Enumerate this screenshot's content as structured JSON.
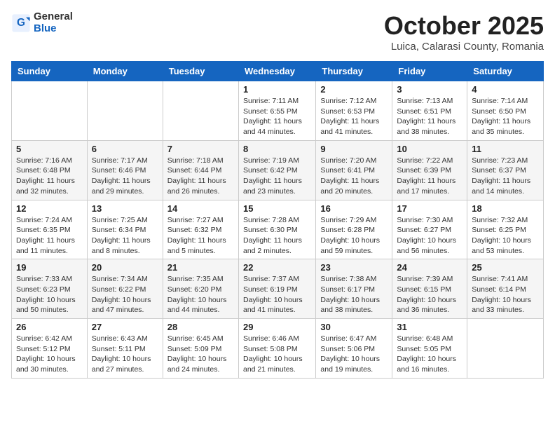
{
  "header": {
    "logo_general": "General",
    "logo_blue": "Blue",
    "month_title": "October 2025",
    "location": "Luica, Calarasi County, Romania"
  },
  "days_of_week": [
    "Sunday",
    "Monday",
    "Tuesday",
    "Wednesday",
    "Thursday",
    "Friday",
    "Saturday"
  ],
  "weeks": [
    [
      {
        "day": "",
        "info": ""
      },
      {
        "day": "",
        "info": ""
      },
      {
        "day": "",
        "info": ""
      },
      {
        "day": "1",
        "info": "Sunrise: 7:11 AM\nSunset: 6:55 PM\nDaylight: 11 hours and 44 minutes."
      },
      {
        "day": "2",
        "info": "Sunrise: 7:12 AM\nSunset: 6:53 PM\nDaylight: 11 hours and 41 minutes."
      },
      {
        "day": "3",
        "info": "Sunrise: 7:13 AM\nSunset: 6:51 PM\nDaylight: 11 hours and 38 minutes."
      },
      {
        "day": "4",
        "info": "Sunrise: 7:14 AM\nSunset: 6:50 PM\nDaylight: 11 hours and 35 minutes."
      }
    ],
    [
      {
        "day": "5",
        "info": "Sunrise: 7:16 AM\nSunset: 6:48 PM\nDaylight: 11 hours and 32 minutes."
      },
      {
        "day": "6",
        "info": "Sunrise: 7:17 AM\nSunset: 6:46 PM\nDaylight: 11 hours and 29 minutes."
      },
      {
        "day": "7",
        "info": "Sunrise: 7:18 AM\nSunset: 6:44 PM\nDaylight: 11 hours and 26 minutes."
      },
      {
        "day": "8",
        "info": "Sunrise: 7:19 AM\nSunset: 6:42 PM\nDaylight: 11 hours and 23 minutes."
      },
      {
        "day": "9",
        "info": "Sunrise: 7:20 AM\nSunset: 6:41 PM\nDaylight: 11 hours and 20 minutes."
      },
      {
        "day": "10",
        "info": "Sunrise: 7:22 AM\nSunset: 6:39 PM\nDaylight: 11 hours and 17 minutes."
      },
      {
        "day": "11",
        "info": "Sunrise: 7:23 AM\nSunset: 6:37 PM\nDaylight: 11 hours and 14 minutes."
      }
    ],
    [
      {
        "day": "12",
        "info": "Sunrise: 7:24 AM\nSunset: 6:35 PM\nDaylight: 11 hours and 11 minutes."
      },
      {
        "day": "13",
        "info": "Sunrise: 7:25 AM\nSunset: 6:34 PM\nDaylight: 11 hours and 8 minutes."
      },
      {
        "day": "14",
        "info": "Sunrise: 7:27 AM\nSunset: 6:32 PM\nDaylight: 11 hours and 5 minutes."
      },
      {
        "day": "15",
        "info": "Sunrise: 7:28 AM\nSunset: 6:30 PM\nDaylight: 11 hours and 2 minutes."
      },
      {
        "day": "16",
        "info": "Sunrise: 7:29 AM\nSunset: 6:28 PM\nDaylight: 10 hours and 59 minutes."
      },
      {
        "day": "17",
        "info": "Sunrise: 7:30 AM\nSunset: 6:27 PM\nDaylight: 10 hours and 56 minutes."
      },
      {
        "day": "18",
        "info": "Sunrise: 7:32 AM\nSunset: 6:25 PM\nDaylight: 10 hours and 53 minutes."
      }
    ],
    [
      {
        "day": "19",
        "info": "Sunrise: 7:33 AM\nSunset: 6:23 PM\nDaylight: 10 hours and 50 minutes."
      },
      {
        "day": "20",
        "info": "Sunrise: 7:34 AM\nSunset: 6:22 PM\nDaylight: 10 hours and 47 minutes."
      },
      {
        "day": "21",
        "info": "Sunrise: 7:35 AM\nSunset: 6:20 PM\nDaylight: 10 hours and 44 minutes."
      },
      {
        "day": "22",
        "info": "Sunrise: 7:37 AM\nSunset: 6:19 PM\nDaylight: 10 hours and 41 minutes."
      },
      {
        "day": "23",
        "info": "Sunrise: 7:38 AM\nSunset: 6:17 PM\nDaylight: 10 hours and 38 minutes."
      },
      {
        "day": "24",
        "info": "Sunrise: 7:39 AM\nSunset: 6:15 PM\nDaylight: 10 hours and 36 minutes."
      },
      {
        "day": "25",
        "info": "Sunrise: 7:41 AM\nSunset: 6:14 PM\nDaylight: 10 hours and 33 minutes."
      }
    ],
    [
      {
        "day": "26",
        "info": "Sunrise: 6:42 AM\nSunset: 5:12 PM\nDaylight: 10 hours and 30 minutes."
      },
      {
        "day": "27",
        "info": "Sunrise: 6:43 AM\nSunset: 5:11 PM\nDaylight: 10 hours and 27 minutes."
      },
      {
        "day": "28",
        "info": "Sunrise: 6:45 AM\nSunset: 5:09 PM\nDaylight: 10 hours and 24 minutes."
      },
      {
        "day": "29",
        "info": "Sunrise: 6:46 AM\nSunset: 5:08 PM\nDaylight: 10 hours and 21 minutes."
      },
      {
        "day": "30",
        "info": "Sunrise: 6:47 AM\nSunset: 5:06 PM\nDaylight: 10 hours and 19 minutes."
      },
      {
        "day": "31",
        "info": "Sunrise: 6:48 AM\nSunset: 5:05 PM\nDaylight: 10 hours and 16 minutes."
      },
      {
        "day": "",
        "info": ""
      }
    ]
  ]
}
